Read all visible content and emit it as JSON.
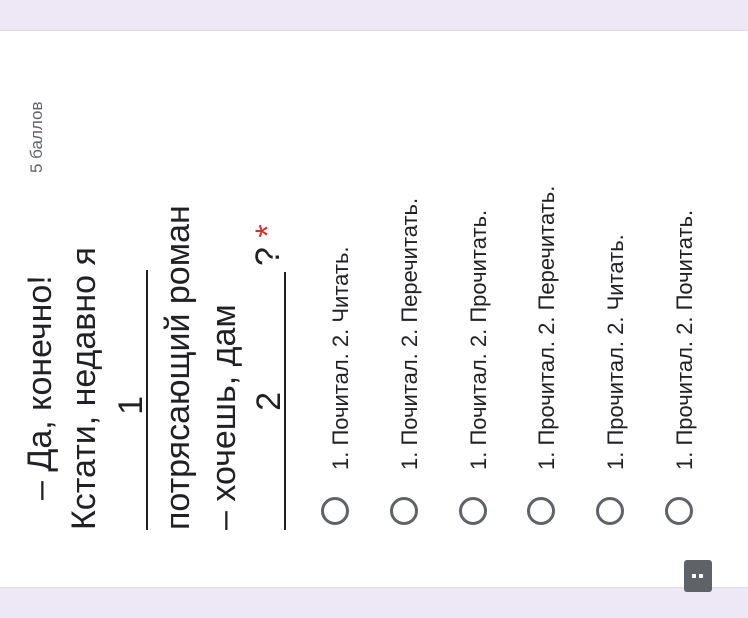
{
  "question": {
    "line1": "– Да, конечно!",
    "line2": "Кстати, недавно я",
    "blank1": "1",
    "line4": "потрясающий роман",
    "line5": "– хочешь, дам",
    "blank2": "2",
    "line6_end": "?",
    "required_mark": "*",
    "points": "5 баллов"
  },
  "options": [
    "1. Почитал. 2. Читать.",
    "1. Почитал. 2. Перечитать.",
    "1. Почитал. 2. Прочитать.",
    "1. Прочитал. 2. Перечитать.",
    "1. Прочитал. 2. Читать.",
    "1. Прочитал. 2. Почитать."
  ],
  "colors": {
    "background": "#ede7f6",
    "required": "#d93025",
    "radio": "#5f6368"
  },
  "icons": {
    "feedback": "feedback-icon"
  }
}
